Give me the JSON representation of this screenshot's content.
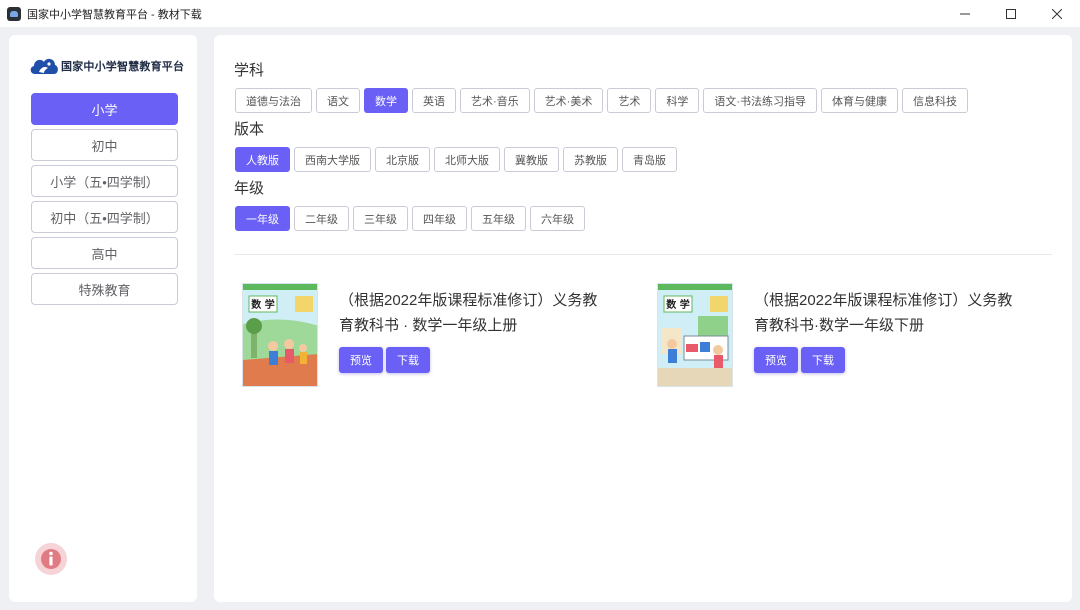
{
  "window": {
    "title": "国家中小学智慧教育平台 - 教材下载"
  },
  "sidebar": {
    "logo_text": "国家中小学智慧教育平台",
    "items": [
      {
        "label": "小学",
        "active": true
      },
      {
        "label": "初中",
        "active": false
      },
      {
        "label": "小学（五•四学制）",
        "active": false
      },
      {
        "label": "初中（五•四学制）",
        "active": false
      },
      {
        "label": "高中",
        "active": false
      },
      {
        "label": "特殊教育",
        "active": false
      }
    ]
  },
  "filters": {
    "subject": {
      "label": "学科",
      "options": [
        "道德与法治",
        "语文",
        "数学",
        "英语",
        "艺术·音乐",
        "艺术·美术",
        "艺术",
        "科学",
        "语文·书法练习指导",
        "体育与健康",
        "信息科技"
      ],
      "selected": "数学"
    },
    "edition": {
      "label": "版本",
      "options": [
        "人教版",
        "西南大学版",
        "北京版",
        "北师大版",
        "冀教版",
        "苏教版",
        "青岛版"
      ],
      "selected": "人教版"
    },
    "grade": {
      "label": "年级",
      "options": [
        "一年级",
        "二年级",
        "三年级",
        "四年级",
        "五年级",
        "六年级"
      ],
      "selected": "一年级"
    }
  },
  "books": [
    {
      "title": "（根据2022年版课程标准修订）义务教育教科书 · 数学一年级上册",
      "cover_title": "数 学",
      "preview_label": "预览",
      "download_label": "下载"
    },
    {
      "title": "（根据2022年版课程标准修订）义务教育教科书·数学一年级下册",
      "cover_title": "数 学",
      "preview_label": "预览",
      "download_label": "下载"
    }
  ],
  "colors": {
    "accent": "#6a60f5",
    "info_bg": "#f6d3d6",
    "info_icon": "#e07b83"
  }
}
